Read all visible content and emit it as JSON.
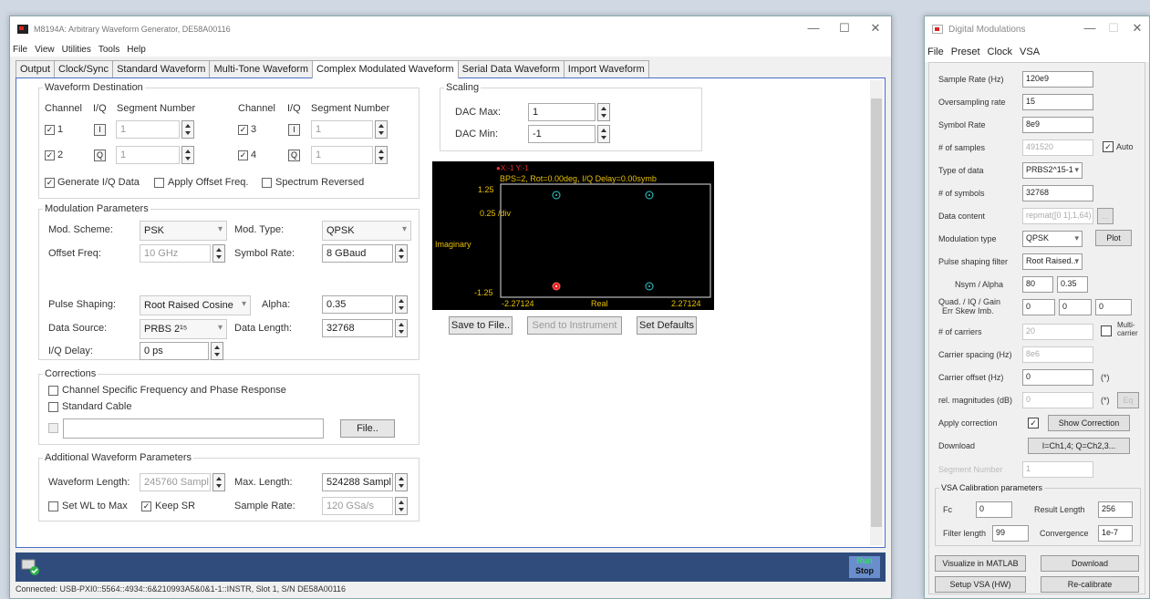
{
  "main": {
    "title": "M8194A: Arbitrary Waveform Generator, DE58A00116",
    "menu": [
      "File",
      "View",
      "Utilities",
      "Tools",
      "Help"
    ],
    "tabs": [
      "Output",
      "Clock/Sync",
      "Standard Waveform",
      "Multi-Tone Waveform",
      "Complex Modulated Waveform",
      "Serial Data Waveform",
      "Import Waveform"
    ],
    "active_tab": "Complex Modulated Waveform",
    "dest": {
      "legend": "Waveform Destination",
      "h_channel": "Channel",
      "h_iq": "I/Q",
      "h_segment": "Segment Number",
      "ch1": "1",
      "ch2": "2",
      "ch3": "3",
      "ch4": "4",
      "i": "I",
      "q": "Q",
      "seg1": "1",
      "seg2": "1",
      "seg3": "1",
      "seg4": "1",
      "gen_iq": "Generate I/Q Data",
      "apply_offset": "Apply Offset Freq.",
      "spectrum_rev": "Spectrum Reversed"
    },
    "mod": {
      "legend": "Modulation Parameters",
      "scheme_label": "Mod. Scheme:",
      "scheme": "PSK",
      "type_label": "Mod. Type:",
      "type": "QPSK",
      "offset_label": "Offset Freq:",
      "offset": "10 GHz",
      "symrate_label": "Symbol Rate:",
      "symrate": "8 GBaud",
      "pulse_label": "Pulse Shaping:",
      "pulse": "Root Raised Cosine",
      "alpha_label": "Alpha:",
      "alpha": "0.35",
      "source_label": "Data Source:",
      "source": "PRBS 2¹⁵",
      "length_label": "Data Length:",
      "length": "32768",
      "iqdelay_label": "I/Q Delay:",
      "iqdelay": "0 ps"
    },
    "corr": {
      "legend": "Corrections",
      "chan_specific": "Channel Specific Frequency and Phase Response",
      "std_cable": "Standard Cable",
      "file_btn": "File.."
    },
    "addl": {
      "legend": "Additional Waveform Parameters",
      "wl_label": "Waveform Length:",
      "wl": "245760 Sampl",
      "maxlen_label": "Max. Length:",
      "maxlen": "524288 Sampl",
      "set_wl": "Set WL to Max",
      "keep_sr": "Keep SR",
      "sr_label": "Sample Rate:",
      "sr": "120 GSa/s"
    },
    "scaling": {
      "legend": "Scaling",
      "dacmax_label": "DAC Max:",
      "dacmax": "1",
      "dacmin_label": "DAC Min:",
      "dacmin": "-1"
    },
    "plot": {
      "markers": "●X:-1         Y:-1",
      "info": "BPS=2, Rot=0.00deg, I/Q Delay=0.00symb",
      "y_top": "1.25",
      "y_div": "0.25\n/div",
      "y_bot": "-1.25",
      "ylabel": "Imaginary",
      "x_left": "-2.27124",
      "xlabel": "Real",
      "x_right": "2.27124"
    },
    "buttons": {
      "save": "Save to File..",
      "send": "Send to Instrument",
      "defaults": "Set Defaults"
    },
    "run": "Run",
    "stop": "Stop",
    "status": "Connected: USB-PXI0::5564::4934::6&210993A5&0&1-1::INSTR, Slot 1, S/N DE58A00116"
  },
  "dm": {
    "title": "Digital Modulations",
    "menu": [
      "File",
      "Preset",
      "Clock",
      "VSA"
    ],
    "sample_rate_label": "Sample Rate (Hz)",
    "sample_rate": "120e9",
    "oversampling_label": "Oversampling rate",
    "oversampling": "15",
    "symbol_rate_label": "Symbol Rate",
    "symbol_rate": "8e9",
    "num_samples_label": "# of samples",
    "num_samples": "491520",
    "auto": "Auto",
    "type_data_label": "Type of data",
    "type_data": "PRBS2^15-1",
    "num_symbols_label": "# of symbols",
    "num_symbols": "32768",
    "data_content_label": "Data content",
    "data_content": "repmat([0 1],1,64)",
    "dots": "...",
    "mod_type_label": "Modulation type",
    "mod_type": "QPSK",
    "plot": "Plot",
    "pulse_label": "Pulse shaping filter",
    "pulse": "Root Raised...",
    "nsym_label": "Nsym / Alpha",
    "nsym": "80",
    "alpha": "0.35",
    "quad_label": "Quad. / IQ  / Gain",
    "quad_label2": "Err   Skew  Imb.",
    "quad1": "0",
    "quad2": "0",
    "quad3": "0",
    "carriers_label": "# of carriers",
    "carriers": "20",
    "multi": "Multi-",
    "multi2": "carrier",
    "spacing_label": "Carrier spacing (Hz)",
    "spacing": "8e6",
    "offset_label": "Carrier offset (Hz)",
    "offset": "0",
    "star": "(*)",
    "relmag_label": "rel. magnitudes (dB)",
    "relmag": "0",
    "eq": "Eq",
    "apply_corr_label": "Apply correction",
    "show_corr": "Show Correction",
    "download_label": "Download",
    "download_map": "I=Ch1,4; Q=Ch2,3...",
    "segnum_label": "Segment Number",
    "segnum": "1",
    "vsa_legend": "VSA Calibration parameters",
    "fc_label": "Fc",
    "fc": "0",
    "result_label": "Result Length",
    "result": "256",
    "filter_label": "Filter length",
    "filter": "99",
    "conv_label": "Convergence",
    "conv": "1e-7",
    "visualize": "Visualize in MATLAB",
    "download": "Download",
    "setup_vsa": "Setup VSA (HW)",
    "recal": "Re-calibrate"
  }
}
